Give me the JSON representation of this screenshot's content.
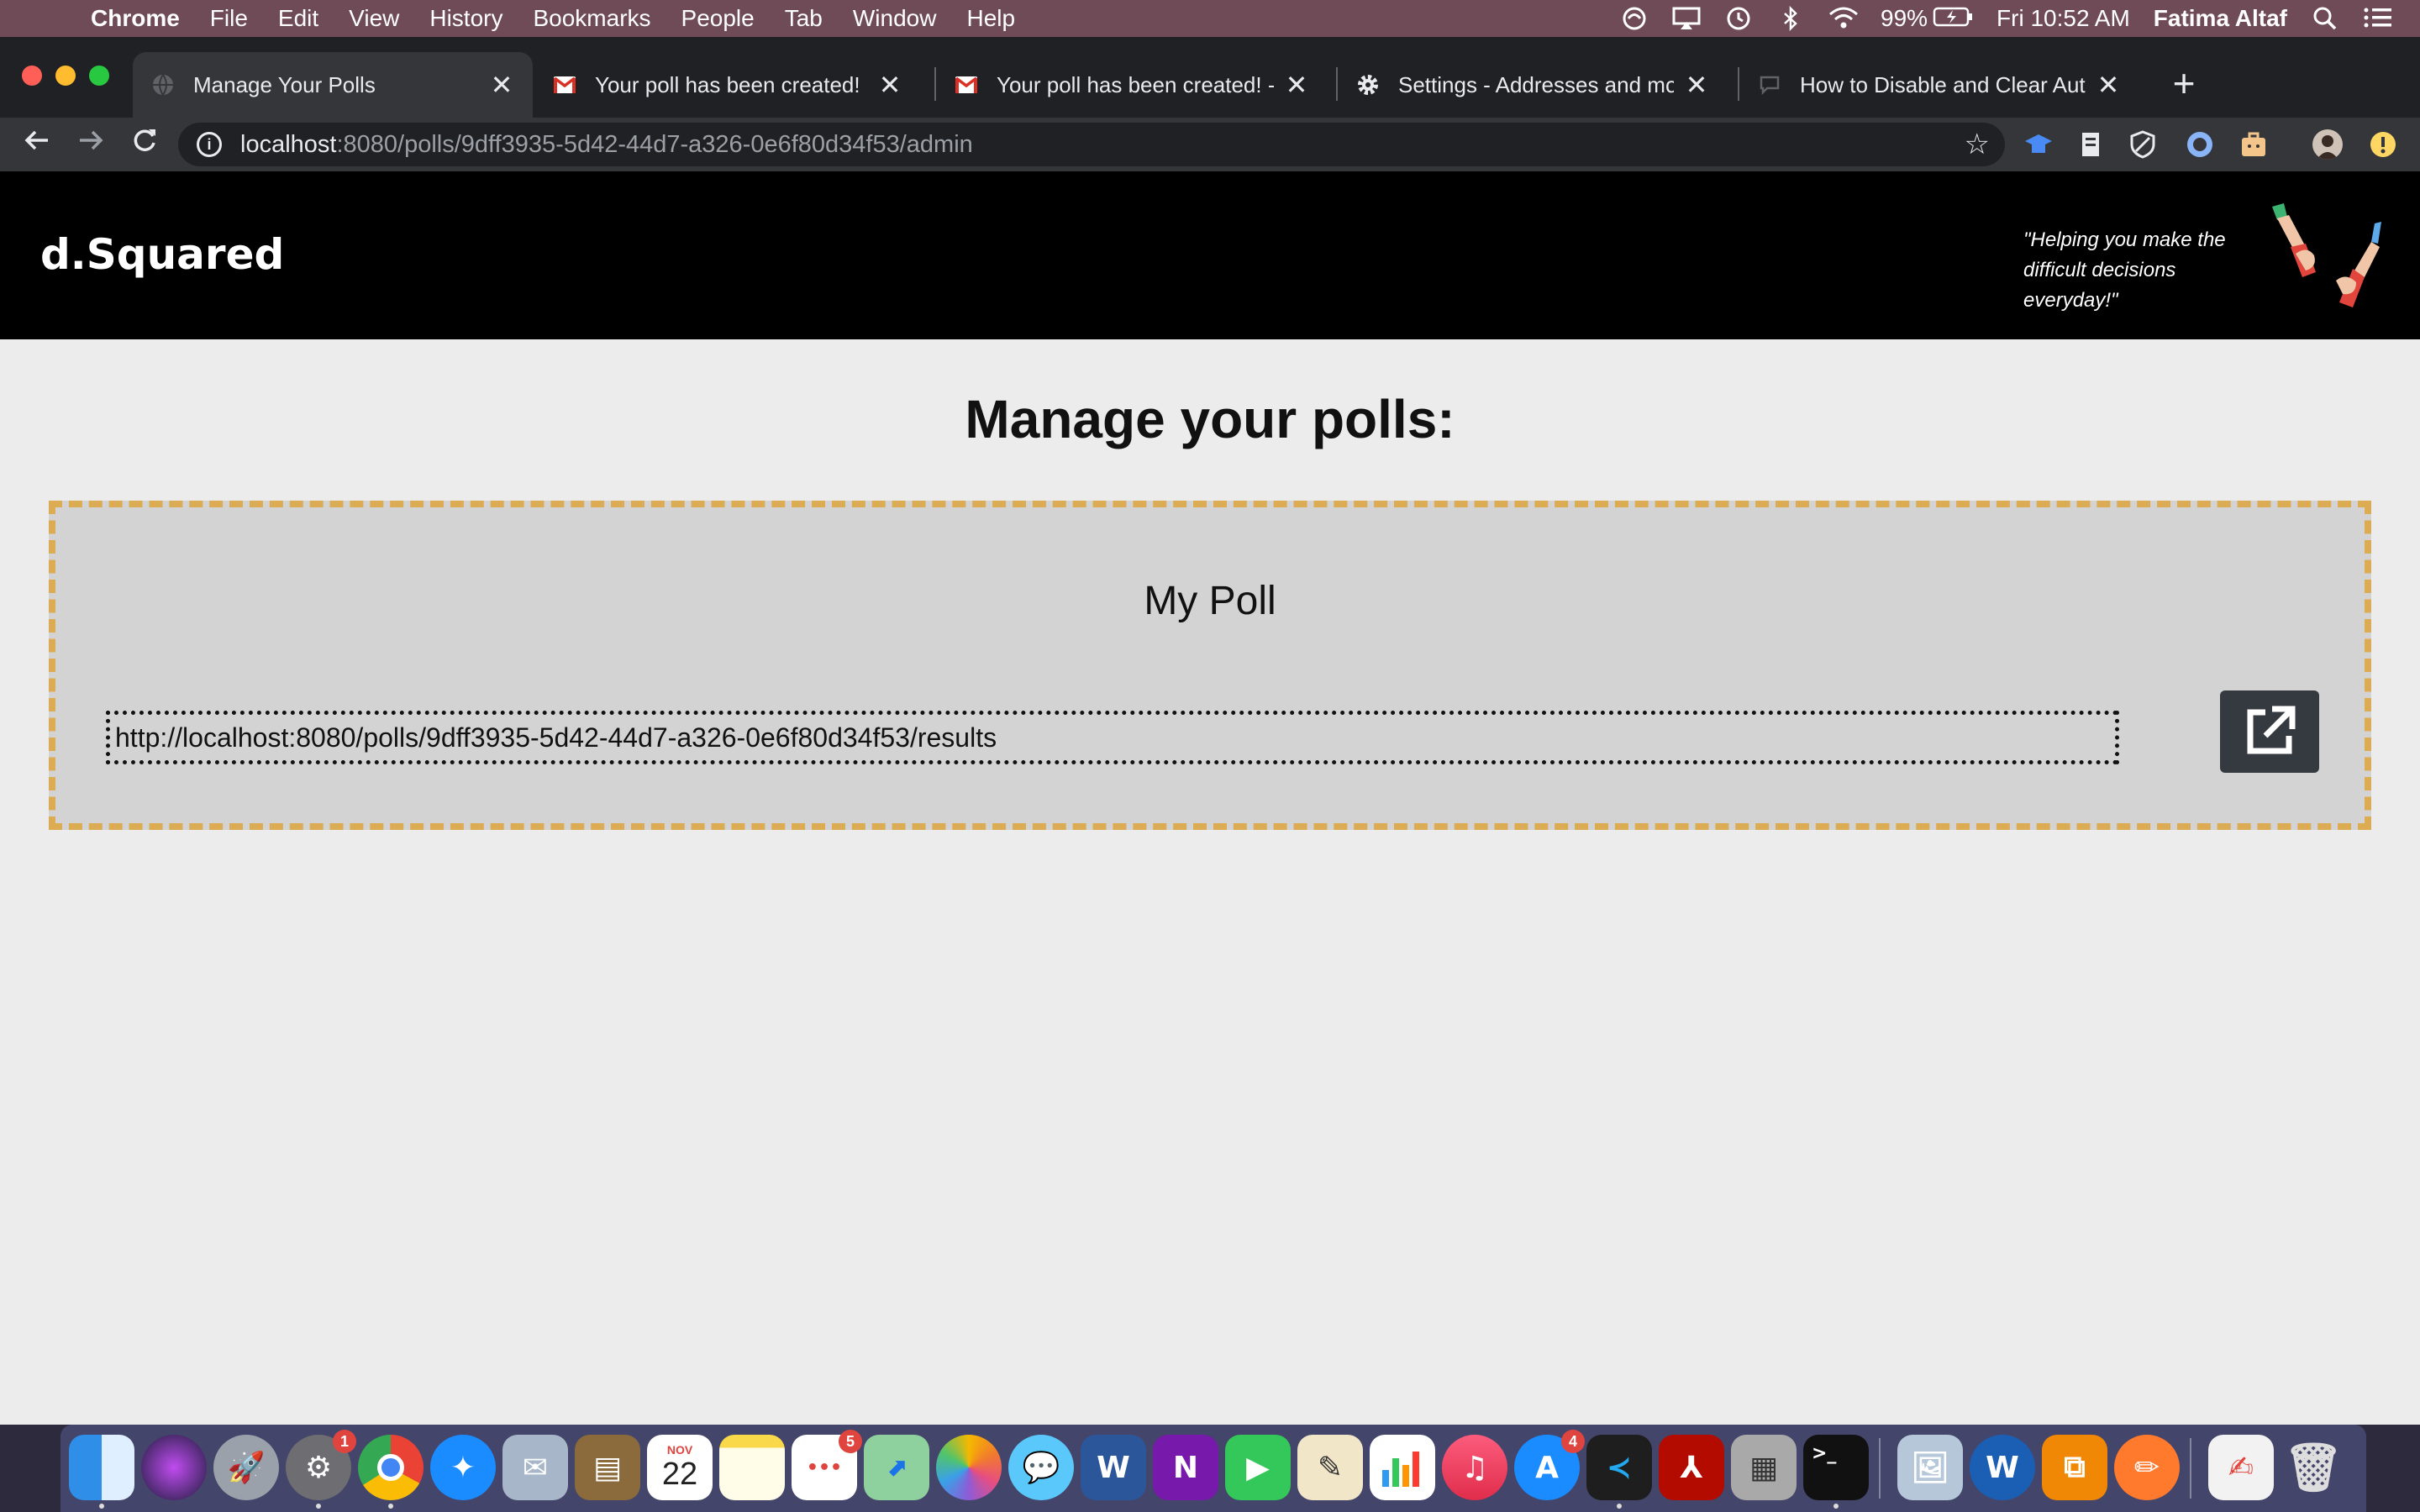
{
  "menubar": {
    "app_name": "Chrome",
    "items": [
      "File",
      "Edit",
      "View",
      "History",
      "Bookmarks",
      "People",
      "Tab",
      "Window",
      "Help"
    ],
    "battery": "99%",
    "clock": "Fri 10:52 AM",
    "user": "Fatima Altaf"
  },
  "tabs": [
    {
      "title": "Manage Your Polls",
      "favicon": "globe-icon",
      "active": true
    },
    {
      "title": "Your poll has been created! - fa",
      "favicon": "gmail-icon",
      "active": false
    },
    {
      "title": "Your poll has been created! - d",
      "favicon": "gmail-icon",
      "active": false
    },
    {
      "title": "Settings - Addresses and more",
      "favicon": "gear-icon",
      "active": false
    },
    {
      "title": "How to Disable and Clear Auto",
      "favicon": "chat-icon",
      "active": false
    }
  ],
  "omnibox": {
    "host": "localhost",
    "path": ":8080/polls/9dff3935-5d42-44d7-a326-0e6f80d34f53/admin"
  },
  "site": {
    "brand": "d.Squared",
    "tagline": "\"Helping you make the difficult decisions everyday!\""
  },
  "main": {
    "title": "Manage your polls:",
    "polls": [
      {
        "name": "My Poll",
        "results_url": "http://localhost:8080/polls/9dff3935-5d42-44d7-a326-0e6f80d34f53/results"
      }
    ]
  },
  "dock": {
    "calendar_month": "NOV",
    "calendar_day": "22",
    "badges": {
      "system_preferences": "1",
      "reminders": "5",
      "app_store": "4"
    }
  },
  "colors": {
    "card_border": "#dcac54",
    "card_bg": "#d3d3d3",
    "header_bg": "#000000",
    "button_bg": "#343a40"
  }
}
